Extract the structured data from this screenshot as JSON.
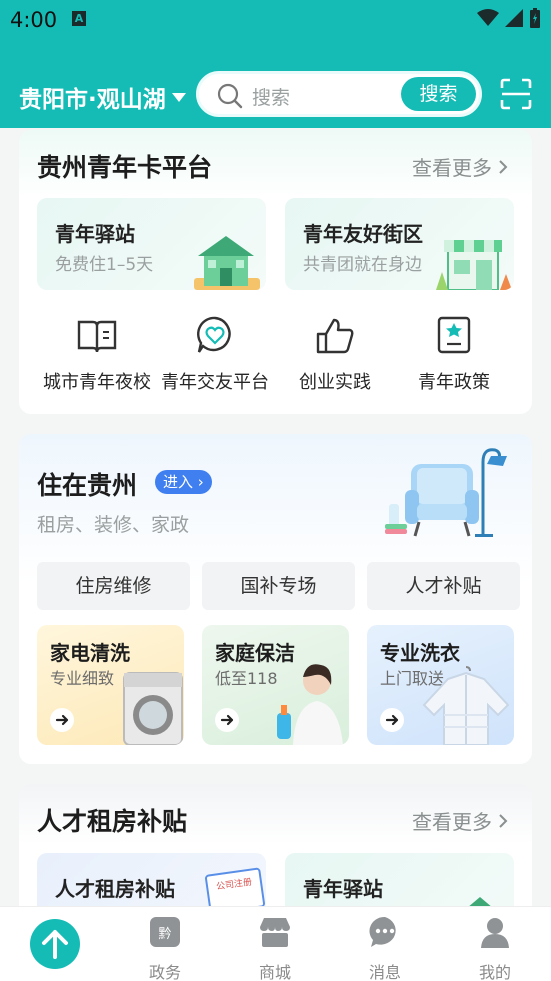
{
  "status": {
    "time": "4:00",
    "notif_icon": "A"
  },
  "header": {
    "city": "贵阳市·观山湖",
    "search_placeholder": "搜索",
    "search_button": "搜索"
  },
  "youth_card": {
    "title": "贵州青年卡平台",
    "more": "查看更多",
    "tiles": [
      {
        "title": "青年驿站",
        "subtitle": "免费住1–5天"
      },
      {
        "title": "青年友好街区",
        "subtitle": "共青团就在身边"
      }
    ],
    "grid": [
      {
        "label": "城市青年夜校",
        "icon": "book-icon"
      },
      {
        "label": "青年交友平台",
        "icon": "heart-chat-icon"
      },
      {
        "label": "创业实践",
        "icon": "thumbs-up-icon"
      },
      {
        "label": "青年政策",
        "icon": "policy-icon"
      }
    ]
  },
  "live_card": {
    "title": "住在贵州",
    "badge": "进入",
    "subtitle": "租房、装修、家政",
    "chips": [
      "住房维修",
      "国补专场",
      "人才补贴"
    ],
    "services": [
      {
        "title": "家电清洗",
        "subtitle": "专业细致",
        "color": "#fff3d6"
      },
      {
        "title": "家庭保洁",
        "subtitle": "低至118",
        "color": "#e6f4e7"
      },
      {
        "title": "专业洗衣",
        "subtitle": "上门取送",
        "color": "#e3effd"
      }
    ]
  },
  "talent_card": {
    "title": "人才租房补贴",
    "more": "查看更多",
    "tiles": [
      {
        "title": "人才租房补贴",
        "tag": "公司注册"
      },
      {
        "title": "青年驿站"
      }
    ]
  },
  "tabbar": {
    "tabs": [
      {
        "label": "政务",
        "icon": "government-icon"
      },
      {
        "label": "商城",
        "icon": "shop-icon"
      },
      {
        "label": "消息",
        "icon": "message-icon"
      },
      {
        "label": "我的",
        "icon": "profile-icon"
      }
    ]
  },
  "colors": {
    "brand": "#15bcb6",
    "accent_blue": "#3f7ff0"
  }
}
